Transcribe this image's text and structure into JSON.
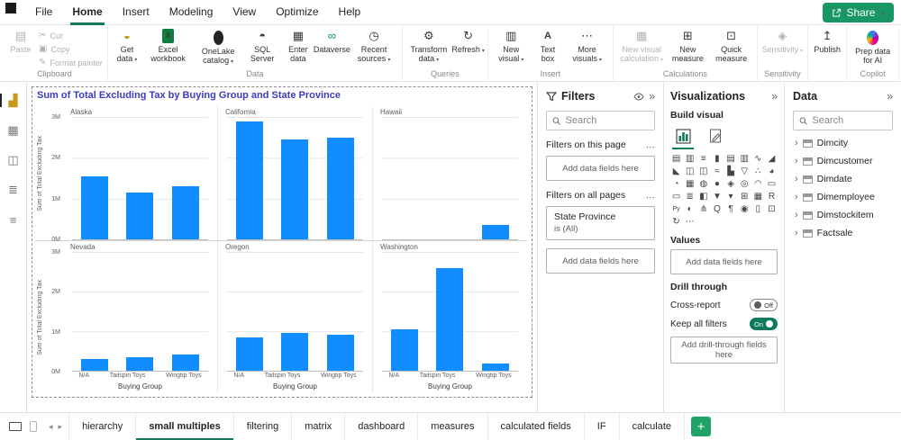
{
  "app": {
    "share_label": "Share"
  },
  "menu": {
    "items": [
      "File",
      "Home",
      "Insert",
      "Modeling",
      "View",
      "Optimize",
      "Help"
    ],
    "active_index": 1
  },
  "icon_glyphs": {
    "paste": "▤",
    "cut": "✂",
    "copy": "▣",
    "format-painter": "✎",
    "get-data": "◒",
    "excel": "",
    "onelake": "",
    "sql-server": "◓",
    "enter-data": "▦",
    "dataverse": "∞",
    "recent-sources": "◷",
    "transform-data": "⚙",
    "refresh": "↻",
    "new-visual": "▥",
    "text-box": "A",
    "more-visuals": "⋯",
    "new-visual-calculation": "▦",
    "new-measure": "⊞",
    "quick-measure": "⊡",
    "sensitivity": "◈",
    "publish": "↥",
    "copilot-ai": "",
    "caret": "▾",
    "chevron": "›"
  },
  "ribbon": {
    "groups": [
      {
        "label": "Clipboard",
        "big": [
          {
            "label": "Paste",
            "icon": "paste",
            "disabled": true
          }
        ],
        "small": [
          {
            "label": "Cut",
            "icon": "cut",
            "disabled": true
          },
          {
            "label": "Copy",
            "icon": "copy",
            "disabled": true
          },
          {
            "label": "Format painter",
            "icon": "format-painter",
            "disabled": true
          }
        ]
      },
      {
        "label": "Data",
        "buttons": [
          {
            "label": "Get data",
            "icon": "get-data",
            "caret": true
          },
          {
            "label": "Excel workbook",
            "icon": "excel"
          },
          {
            "label": "OneLake catalog",
            "icon": "onelake",
            "caret": true
          },
          {
            "label": "SQL Server",
            "icon": "sql-server"
          },
          {
            "label": "Enter data",
            "icon": "enter-data"
          },
          {
            "label": "Dataverse",
            "icon": "dataverse"
          },
          {
            "label": "Recent sources",
            "icon": "recent-sources",
            "caret": true
          }
        ]
      },
      {
        "label": "Queries",
        "buttons": [
          {
            "label": "Transform data",
            "icon": "transform-data",
            "caret": true
          },
          {
            "label": "Refresh",
            "icon": "refresh",
            "caret": true
          }
        ]
      },
      {
        "label": "Insert",
        "buttons": [
          {
            "label": "New visual",
            "icon": "new-visual",
            "caret": true
          },
          {
            "label": "Text box",
            "icon": "text-box"
          },
          {
            "label": "More visuals",
            "icon": "more-visuals",
            "caret": true
          }
        ]
      },
      {
        "label": "Calculations",
        "buttons": [
          {
            "label": "New visual calculation",
            "icon": "new-visual-calculation",
            "caret": true,
            "disabled": true
          },
          {
            "label": "New measure",
            "icon": "new-measure"
          },
          {
            "label": "Quick measure",
            "icon": "quick-measure"
          }
        ]
      },
      {
        "label": "Sensitivity",
        "buttons": [
          {
            "label": "Sensitivity",
            "icon": "sensitivity",
            "caret": true,
            "disabled": true
          }
        ]
      },
      {
        "label": "",
        "buttons": [
          {
            "label": "Publish",
            "icon": "publish"
          }
        ]
      },
      {
        "label": "Copilot",
        "buttons": [
          {
            "label": "Prep data for AI",
            "icon": "copilot-ai"
          }
        ]
      }
    ]
  },
  "sidebar": {
    "items": [
      {
        "name": "report-view",
        "glyph": "▟",
        "active": true
      },
      {
        "name": "table-view",
        "glyph": "▦"
      },
      {
        "name": "model-view",
        "glyph": "◫"
      },
      {
        "name": "dax-query-view",
        "glyph": "≣"
      },
      {
        "name": "tmdl-view",
        "glyph": "≡"
      }
    ]
  },
  "chart_data": {
    "type": "bar",
    "title": "Sum of Total Excluding Tax by Buying Group and State Province",
    "categories": [
      "N/A",
      "Tailspin Toys",
      "Wingtip Toys"
    ],
    "xlabel": "Buying Group",
    "ylabel": "Sum of Total Excluding Tax",
    "ylim": [
      0,
      3000000
    ],
    "yticks": [
      {
        "v": 3000000,
        "label": "3M"
      },
      {
        "v": 2000000,
        "label": "2M"
      },
      {
        "v": 1000000,
        "label": "1M"
      },
      {
        "v": 0,
        "label": "0M"
      }
    ],
    "bar_color": "#118DFF",
    "grid": true,
    "multiples": [
      {
        "name": "Alaska",
        "values": [
          1550000,
          1150000,
          1300000
        ]
      },
      {
        "name": "California",
        "values": [
          2900000,
          2450000,
          2500000
        ]
      },
      {
        "name": "Hawaii",
        "values": [
          0,
          0,
          350000
        ]
      },
      {
        "name": "Nevada",
        "values": [
          300000,
          350000,
          400000
        ]
      },
      {
        "name": "Oregon",
        "values": [
          850000,
          950000,
          900000
        ]
      },
      {
        "name": "Washington",
        "values": [
          1050000,
          2600000,
          180000
        ]
      }
    ]
  },
  "filters": {
    "title": "Filters",
    "search_placeholder": "Search",
    "on_page_label": "Filters on this page",
    "all_pages_label": "Filters on all pages",
    "add_fields_label": "Add data fields here",
    "cards": [
      {
        "field": "State Province",
        "condition": "is (All)"
      }
    ]
  },
  "visualizations": {
    "title": "Visualizations",
    "build_label": "Build visual",
    "values_label": "Values",
    "add_fields_label": "Add data fields here",
    "drill_label": "Drill through",
    "cross_report_label": "Cross-report",
    "cross_report_state": "Off",
    "keep_filters_label": "Keep all filters",
    "keep_filters_state": "On",
    "add_drill_label": "Add drill-through fields here",
    "icons": [
      {
        "name": "stacked-bar-chart",
        "glyph": "▤"
      },
      {
        "name": "stacked-column-chart",
        "glyph": "▥"
      },
      {
        "name": "clustered-bar-chart",
        "glyph": "≡"
      },
      {
        "name": "clustered-column-chart",
        "glyph": "▮"
      },
      {
        "name": "100-stacked-bar-chart",
        "glyph": "▤"
      },
      {
        "name": "100-stacked-column-chart",
        "glyph": "▥"
      },
      {
        "name": "line-chart",
        "glyph": "∿"
      },
      {
        "name": "area-chart",
        "glyph": "◢"
      },
      {
        "name": "stacked-area-chart",
        "glyph": "◣"
      },
      {
        "name": "line-and-stacked-column-chart",
        "glyph": "◫"
      },
      {
        "name": "line-and-clustered-column-chart",
        "glyph": "◫"
      },
      {
        "name": "ribbon-chart",
        "glyph": "≈"
      },
      {
        "name": "waterfall-chart",
        "glyph": "▙"
      },
      {
        "name": "funnel-chart",
        "glyph": "▽"
      },
      {
        "name": "scatter-chart",
        "glyph": "∴"
      },
      {
        "name": "pie-chart",
        "glyph": "◕"
      },
      {
        "name": "donut-chart",
        "glyph": "◔"
      },
      {
        "name": "treemap",
        "glyph": "▦"
      },
      {
        "name": "map",
        "glyph": "◍"
      },
      {
        "name": "filled-map",
        "glyph": "●"
      },
      {
        "name": "shape-map",
        "glyph": "◈"
      },
      {
        "name": "azure-map",
        "glyph": "◎"
      },
      {
        "name": "gauge",
        "glyph": "◠"
      },
      {
        "name": "card",
        "glyph": "▭"
      },
      {
        "name": "new-card",
        "glyph": "▭"
      },
      {
        "name": "multi-row-card",
        "glyph": "≣"
      },
      {
        "name": "kpi",
        "glyph": "◧"
      },
      {
        "name": "slicer",
        "glyph": "▼"
      },
      {
        "name": "new-slicer",
        "glyph": "▾"
      },
      {
        "name": "table",
        "glyph": "⊞"
      },
      {
        "name": "matrix",
        "glyph": "▦"
      },
      {
        "name": "r-script-visual",
        "glyph": "R"
      },
      {
        "name": "python-visual",
        "glyph": "Py"
      },
      {
        "name": "key-influencers",
        "glyph": "◐"
      },
      {
        "name": "decomposition-tree",
        "glyph": "⋔"
      },
      {
        "name": "q-and-a",
        "glyph": "Q"
      },
      {
        "name": "smart-narrative",
        "glyph": "¶"
      },
      {
        "name": "metrics",
        "glyph": "◉"
      },
      {
        "name": "paginated-report",
        "glyph": "▯"
      },
      {
        "name": "power-apps",
        "glyph": "⊡"
      },
      {
        "name": "power-automate",
        "glyph": "↻"
      },
      {
        "name": "more-visuals",
        "glyph": "⋯"
      }
    ]
  },
  "data_pane": {
    "title": "Data",
    "search_placeholder": "Search",
    "fields": [
      "Dimcity",
      "Dimcustomer",
      "Dimdate",
      "Dimemployee",
      "Dimstockitem",
      "Factsale"
    ]
  },
  "pages": {
    "tabs": [
      {
        "label": "hierarchy"
      },
      {
        "label": "small multiples",
        "active": true
      },
      {
        "label": "filtering"
      },
      {
        "label": "matrix"
      },
      {
        "label": "dashboard"
      },
      {
        "label": "measures"
      },
      {
        "label": "calculated fields"
      },
      {
        "label": "IF"
      },
      {
        "label": "calculate"
      }
    ],
    "add_label": "+"
  }
}
